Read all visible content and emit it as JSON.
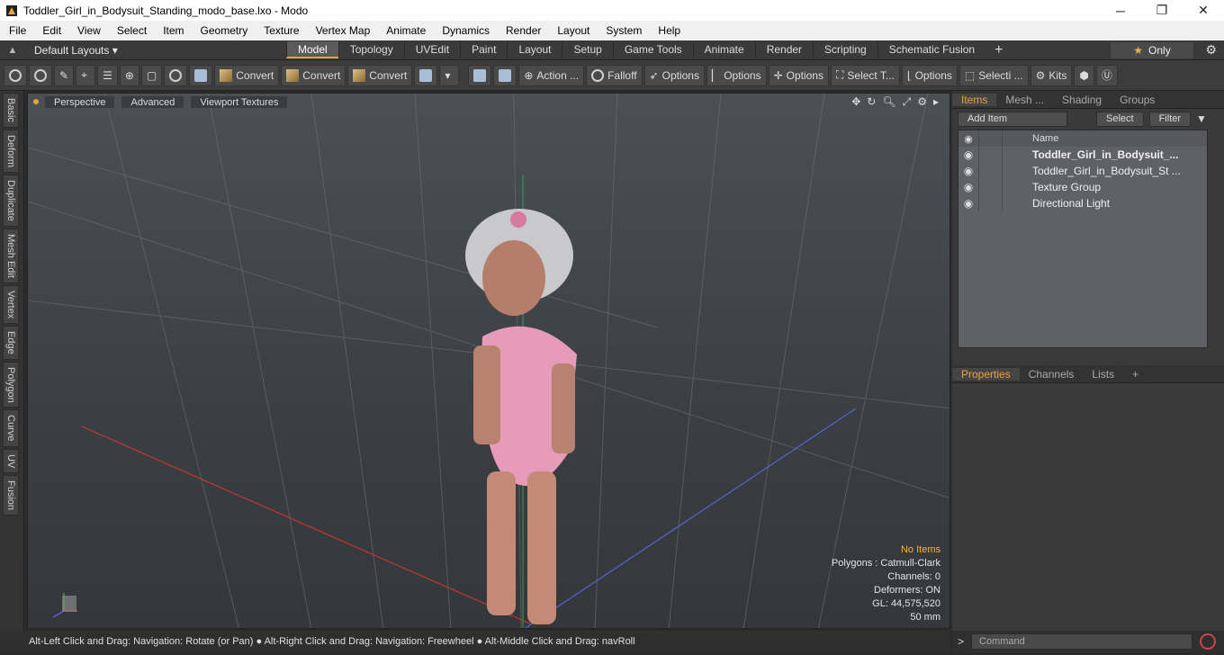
{
  "window": {
    "title": "Toddler_Girl_in_Bodysuit_Standing_modo_base.lxo - Modo",
    "controls": [
      "─",
      "❐",
      "✕"
    ]
  },
  "menu": [
    "File",
    "Edit",
    "View",
    "Select",
    "Item",
    "Geometry",
    "Texture",
    "Vertex Map",
    "Animate",
    "Dynamics",
    "Render",
    "Layout",
    "System",
    "Help"
  ],
  "layout_bar": {
    "dropdown": "Default Layouts ▾",
    "tabs": [
      "Model",
      "Topology",
      "UVEdit",
      "Paint",
      "Layout",
      "Setup",
      "Game Tools",
      "Animate",
      "Render",
      "Scripting",
      "Schematic Fusion"
    ],
    "active_tab": "Model",
    "only_label": "Only"
  },
  "toolbar": {
    "convert1": "Convert",
    "convert2": "Convert",
    "convert3": "Convert",
    "action": "Action ...",
    "falloff": "Falloff",
    "options1": "Options",
    "options2": "Options",
    "options3": "Options",
    "select_t": "Select T...",
    "options4": "Options",
    "selecti": "Selecti ...",
    "kits": "Kits"
  },
  "left_tabs": [
    "Basic",
    "Deform",
    "Duplicate",
    "Mesh Edit",
    "Vertex",
    "Edge",
    "Polygon",
    "Curve",
    "UV",
    "Fusion"
  ],
  "viewport": {
    "perspective": "Perspective",
    "advanced": "Advanced",
    "viewport_textures": "Viewport Textures",
    "info": {
      "no_items": "No Items",
      "polygons": "Polygons : Catmull-Clark",
      "channels": "Channels: 0",
      "deformers": "Deformers: ON",
      "gl": "GL: 44,575,520",
      "mm": "50 mm"
    }
  },
  "status": "Alt-Left Click and Drag: Navigation: Rotate (or Pan) ● Alt-Right Click and Drag: Navigation: Freewheel ● Alt-Middle Click and Drag: navRoll",
  "panel": {
    "tabs": [
      "Items",
      "Mesh ...",
      "Shading",
      "Groups"
    ],
    "add_item": "Add Item",
    "select": "Select",
    "filter": "Filter",
    "name_col": "Name",
    "rows": [
      {
        "name": "Toddler_Girl_in_Bodysuit_...",
        "bold": true
      },
      {
        "name": "Toddler_Girl_in_Bodysuit_St ...",
        "bold": false
      },
      {
        "name": "Texture Group",
        "bold": false
      },
      {
        "name": "Directional Light",
        "bold": false
      }
    ],
    "lower_tabs": [
      "Properties",
      "Channels",
      "Lists"
    ],
    "command_placeholder": "Command"
  }
}
